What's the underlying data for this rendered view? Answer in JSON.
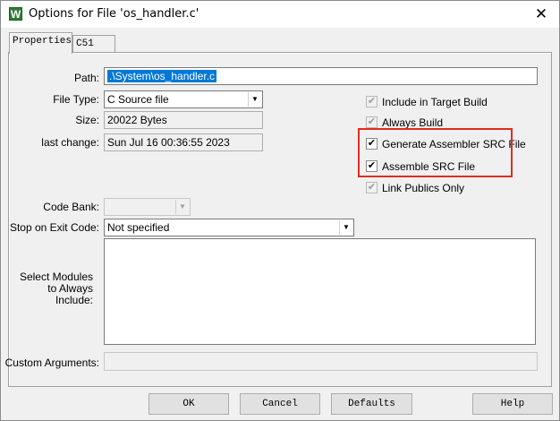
{
  "window": {
    "title": "Options for File 'os_handler.c'",
    "icon_letter": "W",
    "close_symbol": "✕"
  },
  "tabs": [
    {
      "label": "Properties"
    },
    {
      "label": "C51"
    }
  ],
  "fields": {
    "path": {
      "label": "Path:",
      "value": ".\\System\\os_handler.c"
    },
    "file_type": {
      "label": "File Type:",
      "value": "C Source file"
    },
    "size": {
      "label": "Size:",
      "value": "20022 Bytes"
    },
    "last_change": {
      "label": "last change:",
      "value": "Sun Jul 16 00:36:55 2023"
    },
    "code_bank": {
      "label": "Code Bank:",
      "value": ""
    },
    "stop_on_exit": {
      "label": "Stop on Exit Code:",
      "value": "Not specified"
    },
    "select_modules": {
      "label_lines": [
        "Select Modules",
        "to Always",
        "Include:"
      ]
    },
    "custom_arguments": {
      "label": "Custom Arguments:",
      "value": ""
    }
  },
  "checkboxes": [
    {
      "label": "Include in Target Build",
      "checked": true,
      "enabled": false
    },
    {
      "label": "Always Build",
      "checked": true,
      "enabled": false
    },
    {
      "label": "Generate Assembler SRC File",
      "checked": true,
      "enabled": true
    },
    {
      "label": "Assemble SRC File",
      "checked": true,
      "enabled": true
    },
    {
      "label": "Link Publics Only",
      "checked": true,
      "enabled": false
    }
  ],
  "check_symbol": "✔",
  "dropdown_symbol": "▼",
  "highlight_color": "#e02d1f",
  "buttons": {
    "ok": "OK",
    "cancel": "Cancel",
    "defaults": "Defaults",
    "help": "Help"
  }
}
